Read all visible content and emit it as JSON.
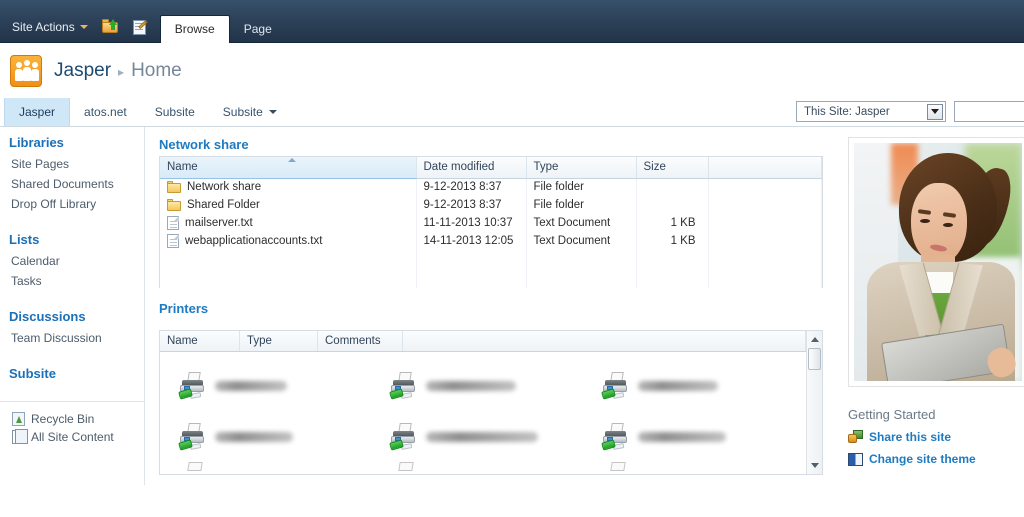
{
  "ribbon": {
    "site_actions": "Site Actions",
    "navigate_up_icon": "navigate-up-icon",
    "edit_page_icon": "edit-page-icon",
    "tabs": [
      {
        "label": "Browse",
        "active": true
      },
      {
        "label": "Page",
        "active": false
      }
    ]
  },
  "header": {
    "logo_icon": "site-logo-icon",
    "site_name": "Jasper",
    "separator": "▸",
    "page_name": "Home"
  },
  "topnav": {
    "tabs": [
      {
        "label": "Jasper",
        "active": true,
        "has_caret": false
      },
      {
        "label": "atos.net",
        "active": false,
        "has_caret": false
      },
      {
        "label": "Subsite",
        "active": false,
        "has_caret": false
      },
      {
        "label": "Subsite",
        "active": false,
        "has_caret": true
      }
    ]
  },
  "search": {
    "scope_label": "This Site: Jasper",
    "scope_caret_icon": "chevron-down-icon",
    "input_value": "",
    "input_placeholder": ""
  },
  "sidebar": {
    "groups": [
      {
        "heading": "Libraries",
        "items": [
          "Site Pages",
          "Shared Documents",
          "Drop Off Library"
        ]
      },
      {
        "heading": "Lists",
        "items": [
          "Calendar",
          "Tasks"
        ]
      },
      {
        "heading": "Discussions",
        "items": [
          "Team Discussion"
        ]
      },
      {
        "heading": "Subsite",
        "items": []
      }
    ],
    "footer": [
      {
        "label": "Recycle Bin",
        "icon": "recycle-bin-icon"
      },
      {
        "label": "All Site Content",
        "icon": "all-site-content-icon"
      }
    ]
  },
  "network_share": {
    "title": "Network share",
    "columns": [
      "Name",
      "Date modified",
      "Type",
      "Size"
    ],
    "sorted_column": "Name",
    "sort_direction": "asc",
    "rows": [
      {
        "name": "Network share",
        "icon": "folder-icon",
        "date_modified": "9-12-2013 8:37",
        "type": "File folder",
        "size": ""
      },
      {
        "name": "Shared Folder",
        "icon": "folder-icon",
        "date_modified": "9-12-2013 8:37",
        "type": "File folder",
        "size": ""
      },
      {
        "name": "mailserver.txt",
        "icon": "text-file-icon",
        "date_modified": "11-11-2013 10:37",
        "type": "Text Document",
        "size": "1 KB"
      },
      {
        "name": "webapplicationaccounts.txt",
        "icon": "text-file-icon",
        "date_modified": "14-11-2013 12:05",
        "type": "Text Document",
        "size": "1 KB"
      }
    ]
  },
  "printers": {
    "title": "Printers",
    "columns": [
      "Name",
      "Type",
      "Comments"
    ],
    "items": [
      {
        "icon": "printer-icon",
        "name_redacted": true
      },
      {
        "icon": "printer-icon",
        "name_redacted": true
      },
      {
        "icon": "printer-icon",
        "name_redacted": true
      },
      {
        "icon": "printer-icon",
        "name_redacted": true
      },
      {
        "icon": "printer-icon",
        "name_redacted": true
      },
      {
        "icon": "printer-icon",
        "name_redacted": true
      }
    ],
    "scroll_up_icon": "scroll-up-arrow-icon",
    "scroll_down_icon": "scroll-down-arrow-icon"
  },
  "rightcol": {
    "image_alt": "woman-with-laptop-photo",
    "getting_started_title": "Getting Started",
    "links": [
      {
        "label": "Share this site",
        "icon": "share-site-icon"
      },
      {
        "label": "Change site theme",
        "icon": "change-theme-icon"
      }
    ]
  },
  "colors": {
    "ribbon_dark": "#2b3f56",
    "link_blue": "#1f7bc1",
    "heading_blue": "#1b70b8",
    "accent_orange": "#f08f16",
    "tab_active_blue": "#cfe7f7"
  }
}
